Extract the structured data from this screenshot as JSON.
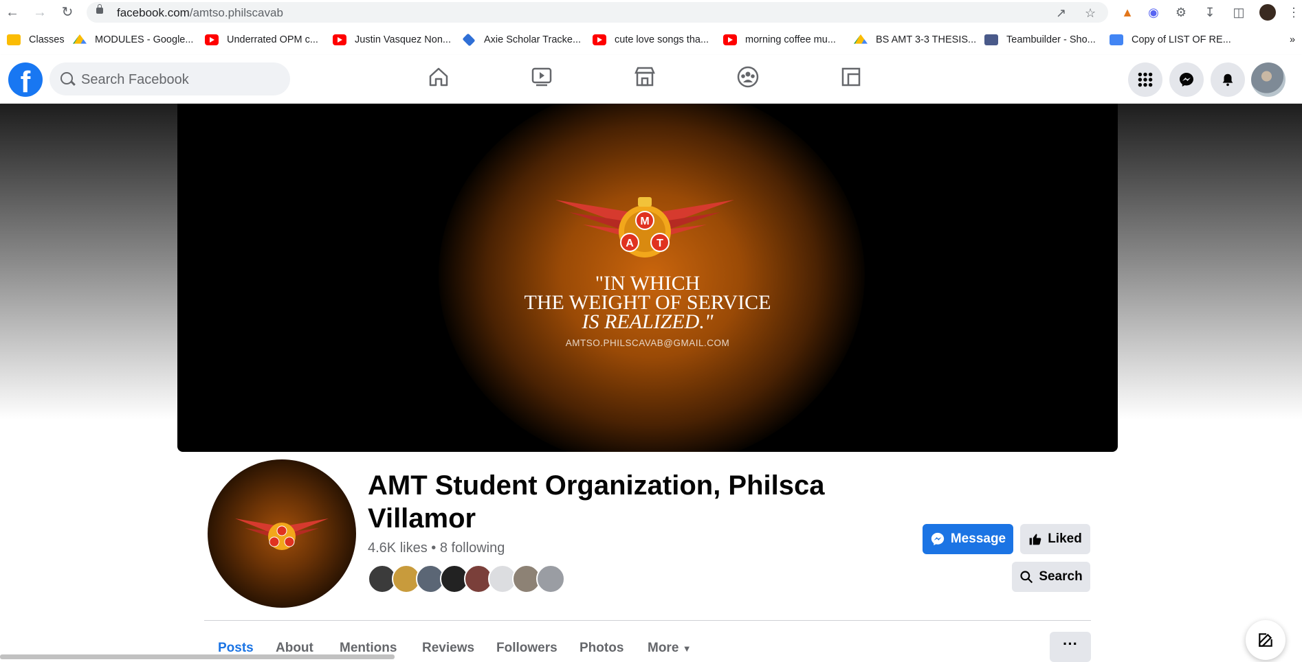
{
  "browser": {
    "url_host": "facebook.com",
    "url_path": "/amtso.philscavab",
    "bookmarks": [
      {
        "label": "Classes",
        "icon": "classroom-icon"
      },
      {
        "label": "MODULES - Google...",
        "icon": "drive-icon"
      },
      {
        "label": "Underrated OPM c...",
        "icon": "youtube-icon"
      },
      {
        "label": "Justin Vasquez Non...",
        "icon": "youtube-icon"
      },
      {
        "label": "Axie Scholar Tracke...",
        "icon": "axie-icon"
      },
      {
        "label": "cute love songs tha...",
        "icon": "youtube-icon"
      },
      {
        "label": "morning coffee mu...",
        "icon": "youtube-icon"
      },
      {
        "label": "BS AMT 3-3 THESIS...",
        "icon": "drive-icon"
      },
      {
        "label": "Teambuilder - Sho...",
        "icon": "teambuilder-icon"
      },
      {
        "label": "Copy of LIST OF RE...",
        "icon": "docs-icon"
      }
    ],
    "bookmarks_overflow": "»"
  },
  "facebook": {
    "search_placeholder": "Search Facebook",
    "accent": "#1877f2"
  },
  "cover": {
    "emblem_letters": [
      "M",
      "A",
      "T"
    ],
    "quote_line1": "\"IN WHICH",
    "quote_line2": "THE WEIGHT OF SERVICE",
    "quote_line3": "IS REALIZED.\"",
    "email": "AMTSO.PHILSCAVAB@GMAIL.COM"
  },
  "page": {
    "name": "AMT Student Organization, Philsca Villamor",
    "stats": "4.6K likes • 8 following",
    "message_label": "Message",
    "liked_label": "Liked",
    "search_label": "Search",
    "more_dots": "···"
  },
  "tabs": [
    {
      "label": "Posts",
      "active": true
    },
    {
      "label": "About"
    },
    {
      "label": "Mentions"
    },
    {
      "label": "Reviews"
    },
    {
      "label": "Followers"
    },
    {
      "label": "Photos"
    },
    {
      "label": "More"
    }
  ]
}
